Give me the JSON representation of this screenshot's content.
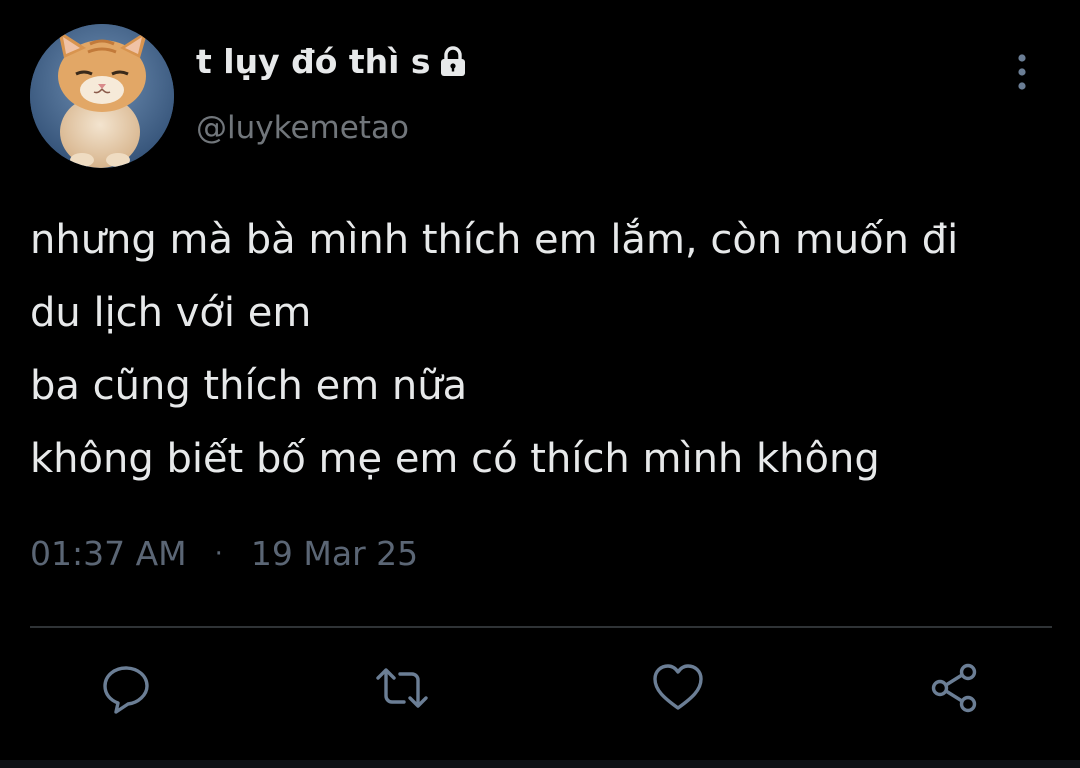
{
  "author": {
    "display_name": "t lụy đó thì s",
    "handle": "@luykemetao",
    "avatar_icon": "orange-kitten-avatar",
    "protected_icon": "lock-icon"
  },
  "tweet": {
    "lines": [
      "nhưng mà bà mình thích em lắm, còn muốn đi",
      "du lịch với em",
      "ba cũng thích em nữa",
      "không biết bố mẹ em có thích mình không"
    ],
    "time": "01:37 AM",
    "separator": "·",
    "date": "19 Mar 25"
  },
  "actions": {
    "reply_icon": "reply-icon",
    "retweet_icon": "retweet-icon",
    "like_icon": "like-icon",
    "share_icon": "share-icon",
    "more_icon": "more-vertical-icon"
  },
  "colors": {
    "background": "#000000",
    "text": "#e7e9ea",
    "secondary_text": "#71767b",
    "meta_text": "#5b6675",
    "icon": "#6b7e95",
    "divider": "#2f3336"
  }
}
